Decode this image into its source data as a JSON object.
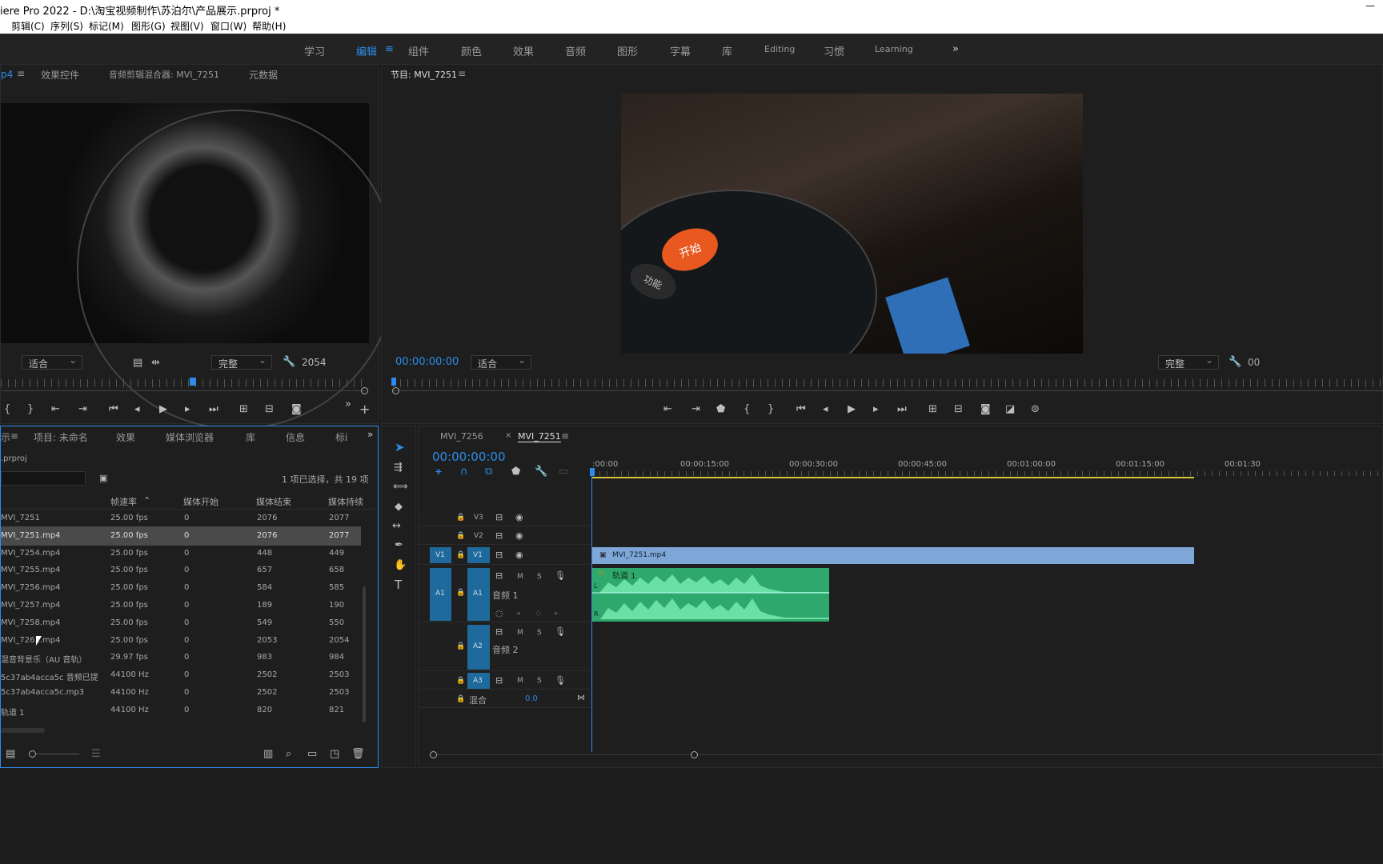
{
  "window": {
    "title": "iere Pro 2022 - D:\\淘宝视频制作\\苏泊尔\\产品展示.prproj *",
    "minimize": "—"
  },
  "menu": [
    "剪辑(C)",
    "序列(S)",
    "标记(M)",
    "图形(G)",
    "视图(V)",
    "窗口(W)",
    "帮助(H)"
  ],
  "workspaces": [
    "学习",
    "编辑",
    "组件",
    "颜色",
    "效果",
    "音频",
    "图形",
    "字幕",
    "库",
    "Editing",
    "习惯",
    "Learning"
  ],
  "workspace_active": "编辑",
  "source_panel": {
    "tabs": [
      "p4",
      "效果控件",
      "音频剪辑混合器: MVI_7251",
      "元数据"
    ],
    "fit": "适合",
    "quality": "完整",
    "frame": "2054"
  },
  "program_panel": {
    "title": "节目: MVI_7251",
    "timecode": "00:00:00:00",
    "fit": "适合",
    "quality": "完整",
    "right_timecode": "00",
    "button_text": [
      "开始",
      "功能"
    ]
  },
  "project_panel": {
    "tabs": [
      "示",
      "项目: 未命名",
      "效果",
      "媒体浏览器",
      "库",
      "信息",
      "标i"
    ],
    "filename": ".prproj",
    "selection": "1 项已选择，共 19 项",
    "columns": [
      "帧速率",
      "媒体开始",
      "媒体结束",
      "媒体持续"
    ],
    "rows": [
      {
        "name": "MVI_7251",
        "fps": "25.00 fps",
        "start": "0",
        "end": "2076",
        "dur": "2077"
      },
      {
        "name": "MVI_7251.mp4",
        "fps": "25.00 fps",
        "start": "0",
        "end": "2076",
        "dur": "2077",
        "selected": true
      },
      {
        "name": "MVI_7254.mp4",
        "fps": "25.00 fps",
        "start": "0",
        "end": "448",
        "dur": "449"
      },
      {
        "name": "MVI_7255.mp4",
        "fps": "25.00 fps",
        "start": "0",
        "end": "657",
        "dur": "658"
      },
      {
        "name": "MVI_7256.mp4",
        "fps": "25.00 fps",
        "start": "0",
        "end": "584",
        "dur": "585"
      },
      {
        "name": "MVI_7257.mp4",
        "fps": "25.00 fps",
        "start": "0",
        "end": "189",
        "dur": "190"
      },
      {
        "name": "MVI_7258.mp4",
        "fps": "25.00 fps",
        "start": "0",
        "end": "549",
        "dur": "550"
      },
      {
        "name": "MVI_7261.mp4",
        "fps": "25.00 fps",
        "start": "0",
        "end": "2053",
        "dur": "2054"
      },
      {
        "name": "混音背景乐（AU 音轨）",
        "fps": "29.97 fps",
        "start": "0",
        "end": "983",
        "dur": "984"
      },
      {
        "name": "5c37ab4acca5c 音频已提",
        "fps": "44100 Hz",
        "start": "0",
        "end": "2502",
        "dur": "2503"
      },
      {
        "name": "5c37ab4acca5c.mp3",
        "fps": "44100 Hz",
        "start": "0",
        "end": "2502",
        "dur": "2503"
      },
      {
        "name": "轨道 1",
        "fps": "44100 Hz",
        "start": "0",
        "end": "820",
        "dur": "821"
      }
    ]
  },
  "timeline": {
    "tabs": [
      "MVI_7256",
      "MVI_7251"
    ],
    "active_tab": "MVI_7251",
    "timecode": "00:00:00:00",
    "ruler": [
      ":00:00",
      "00:00:15:00",
      "00:00:30:00",
      "00:00:45:00",
      "00:01:00:00",
      "00:01:15:00",
      "00:01:30"
    ],
    "tracks": {
      "v3": "V3",
      "v2": "V2",
      "v1": "V1",
      "v1_src": "V1",
      "a1": "A1",
      "a1_src": "A1",
      "a1_name": "音频 1",
      "a2": "A2",
      "a2_name": "音频 2",
      "a3": "A3",
      "mix": "混合",
      "mix_value": "0.0",
      "m": "M",
      "s": "S"
    },
    "video_clip": "MVI_7251.mp4",
    "audio_clip": "轨道 1",
    "audio_fx": "fx",
    "audio_channel_l": "L",
    "audio_channel_r": "R"
  },
  "colors": {
    "accent": "#2d8ceb",
    "video_clip": "#7ea6d6",
    "audio_clip": "#2fa86e",
    "audio_wave": "#6be0a6",
    "track_src": "#1e6a9c"
  }
}
